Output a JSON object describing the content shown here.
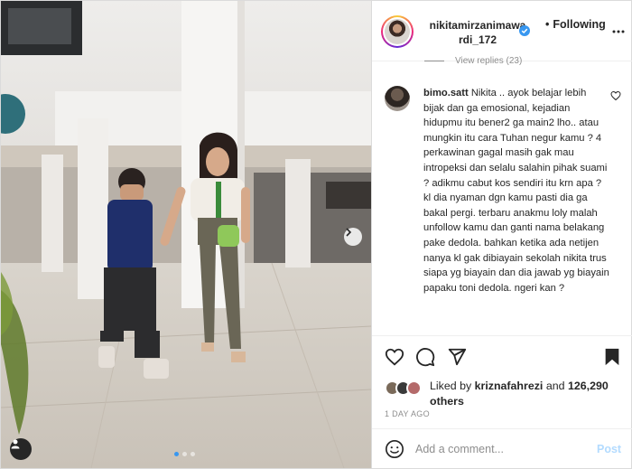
{
  "post": {
    "username_line1": "nikitamirzanimawa",
    "username_line2": "rdi_172",
    "follow_status": "Following",
    "view_replies": "View replies (23)"
  },
  "comment": {
    "username": "bimo.satt",
    "text": "Nikita .. ayok belajar lebih bijak dan ga emosional, kejadian hidupmu itu bener2 ga main2 lho.. atau mungkin itu cara Tuhan negur kamu ? 4 perkawinan gagal masih gak mau intropeksi dan selalu salahin pihak suami ? adikmu cabut kos sendiri itu krn apa ? kl dia nyaman dgn kamu pasti dia ga bakal pergi. terbaru anakmu loly malah unfollow kamu dan ganti nama belakang pake dedola. bahkan ketika ada netijen nanya kl gak dibiayain sekolah nikita trus siapa yg biayain dan dia jawab yg biayain papaku toni dedola. ngeri kan ?"
  },
  "likes": {
    "prefix": "Liked by",
    "liker": "kriznafahrezi",
    "middle": "and",
    "count": "126,290",
    "suffix": "others"
  },
  "timestamp": "1 DAY AGO",
  "add_comment": {
    "placeholder": "Add a comment...",
    "post_label": "Post"
  },
  "carousel": {
    "slides": 3,
    "active": 1
  },
  "icons": {
    "verified": "verified-badge-icon",
    "more": "more-options-icon",
    "heart": "heart-icon",
    "comment": "comment-bubble-icon",
    "share": "paper-plane-icon",
    "save": "bookmark-icon",
    "emoji": "emoji-icon",
    "user_tag": "user-tag-icon",
    "next": "chevron-right-icon"
  },
  "colors": {
    "accent": "#3897f0",
    "post_button": "#b3dbff",
    "secondary_text": "#8e8e8e",
    "ring": "#ee2a7b"
  }
}
